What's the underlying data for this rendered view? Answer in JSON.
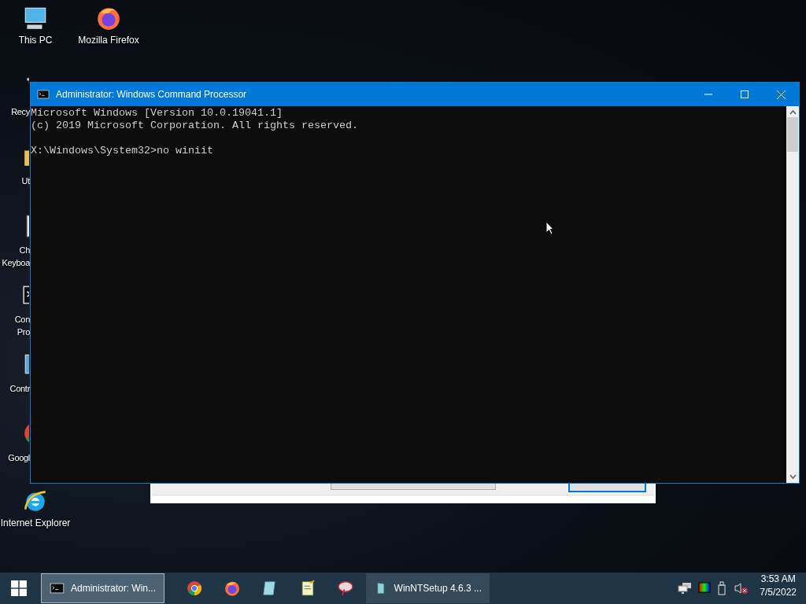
{
  "desktop_icons": [
    {
      "kind": "computer",
      "label": [
        "This PC"
      ]
    },
    {
      "kind": "firefox",
      "label": [
        "Mozilla Firefox"
      ]
    },
    {
      "kind": "bin",
      "label": [
        "Recy"
      ]
    },
    {
      "kind": "folder",
      "label": [
        "Ut"
      ]
    },
    {
      "kind": "keyboard",
      "label": [
        "Ch",
        "Keyboa"
      ]
    },
    {
      "kind": "console",
      "label": [
        "Con",
        "Pro"
      ]
    },
    {
      "kind": "panel",
      "label": [
        "Contr"
      ]
    },
    {
      "kind": "chrome",
      "label": [
        "Googl"
      ]
    },
    {
      "kind": "ie",
      "label": [
        "Internet Explorer"
      ]
    }
  ],
  "console_window": {
    "title": "Administrator: Windows Command Processor",
    "lines": [
      {
        "kind": "output",
        "text": "Microsoft Windows [Version 10.0.19041.1]"
      },
      {
        "kind": "output",
        "text": "(c) 2019 Microsoft Corporation. All rights reserved."
      },
      {
        "kind": "prompt",
        "text": "X:\\Windows\\System32>no winiit"
      }
    ]
  },
  "taskbar": {
    "items": [
      {
        "kind": "console",
        "label": "Administrator: Win...",
        "selected": true
      },
      {
        "kind": "chrome",
        "selected": false
      },
      {
        "kind": "firefox",
        "selected": false
      },
      {
        "kind": "notepad",
        "selected": false
      },
      {
        "kind": "editor",
        "selected": false
      },
      {
        "kind": "paint",
        "selected": false
      },
      {
        "kind": "setup",
        "label": "WinNTSetup 4.6.3   ...",
        "selected": false
      }
    ],
    "time": "3:53 AM",
    "date": "7/5/2022"
  }
}
